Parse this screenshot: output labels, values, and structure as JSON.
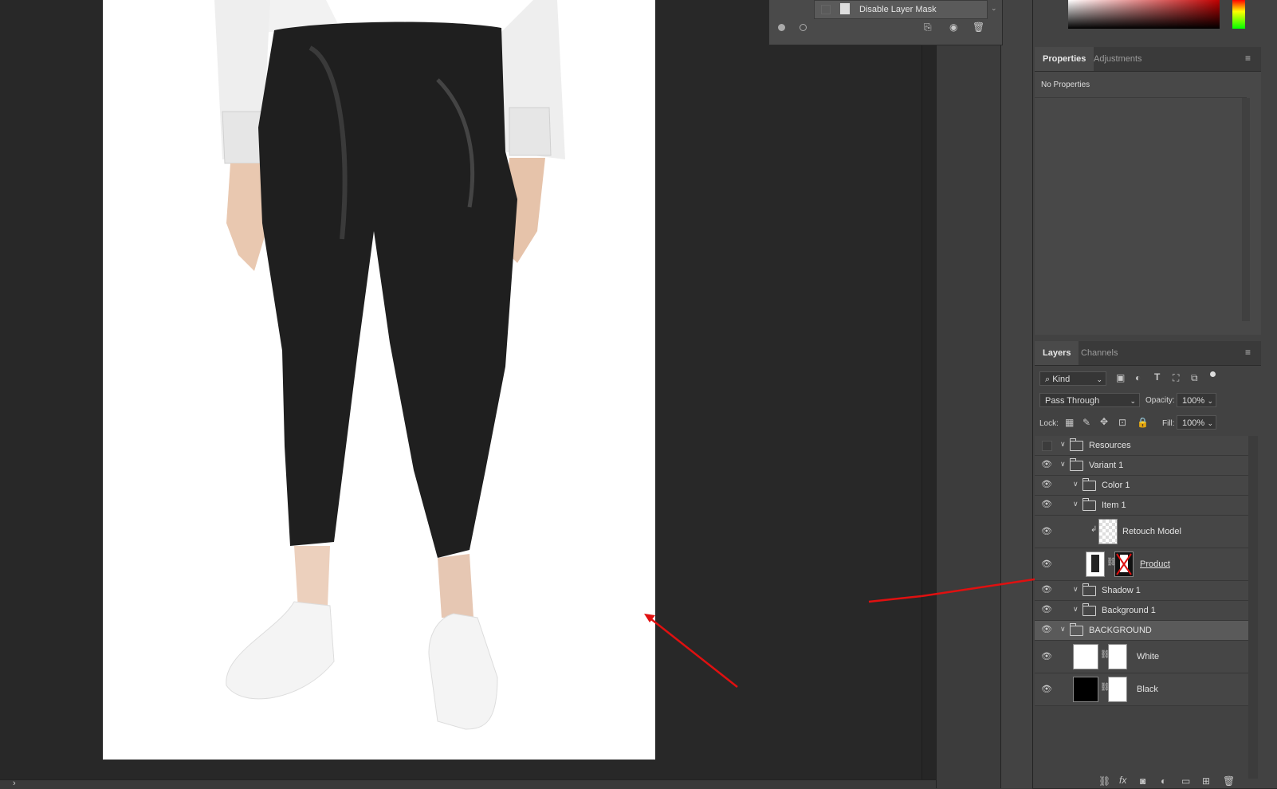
{
  "history_panel": {
    "step_label": "Disable Layer Mask"
  },
  "properties_panel": {
    "tabs": [
      "Properties",
      "Adjustments"
    ],
    "message": "No Properties"
  },
  "layers_panel": {
    "tabs": [
      "Layers",
      "Channels"
    ],
    "filter_kind": "Kind",
    "blend_mode": "Pass Through",
    "opacity_label": "Opacity:",
    "opacity_value": "100%",
    "lock_label": "Lock:",
    "fill_label": "Fill:",
    "fill_value": "100%",
    "layers": [
      {
        "name": "Resources",
        "type": "group",
        "visible": false,
        "indent": 0
      },
      {
        "name": "Variant 1",
        "type": "group",
        "visible": true,
        "indent": 0
      },
      {
        "name": "Color 1",
        "type": "group",
        "visible": true,
        "indent": 1
      },
      {
        "name": "Item 1",
        "type": "group",
        "visible": true,
        "indent": 1
      },
      {
        "name": "Retouch Model",
        "type": "layer",
        "visible": true,
        "indent": 2
      },
      {
        "name": "Product",
        "type": "layer",
        "visible": true,
        "indent": 2
      },
      {
        "name": "Shadow 1",
        "type": "group",
        "visible": true,
        "indent": 1
      },
      {
        "name": "Background 1",
        "type": "group",
        "visible": true,
        "indent": 1
      },
      {
        "name": "BACKGROUND",
        "type": "group",
        "visible": true,
        "indent": 0,
        "selected": true
      },
      {
        "name": "White",
        "type": "fill-layer",
        "visible": true,
        "indent": 1
      },
      {
        "name": "Black",
        "type": "fill-layer",
        "visible": true,
        "indent": 1
      }
    ]
  },
  "status_bar": {
    "arrow": "›"
  },
  "colors": {
    "annotation_arrow": "#e01010",
    "selected_row": "#5a5a5a"
  }
}
